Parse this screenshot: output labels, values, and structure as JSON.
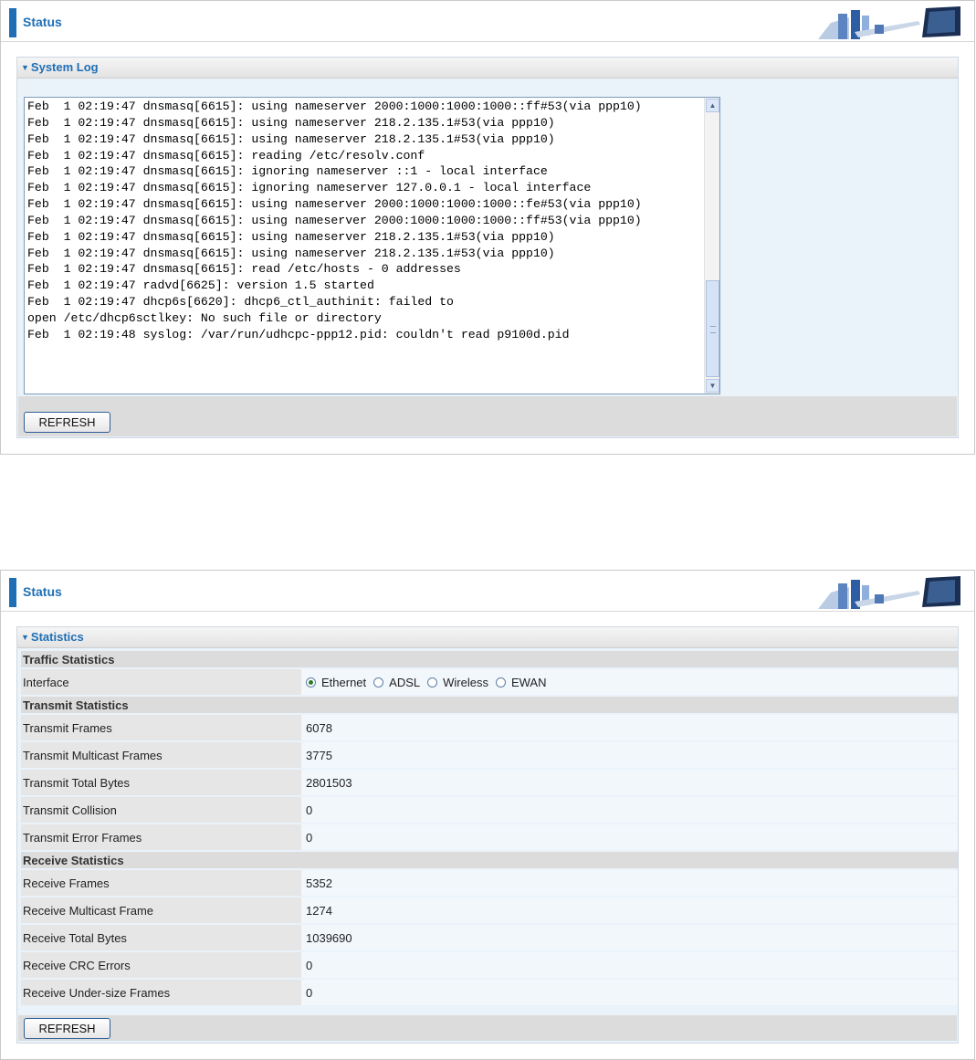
{
  "panel1": {
    "title": "Status",
    "section_title": "System Log",
    "log_text": "Feb  1 02:19:47 dnsmasq[6615]: using nameserver 2000:1000:1000:1000::ff#53(via ppp10)\nFeb  1 02:19:47 dnsmasq[6615]: using nameserver 218.2.135.1#53(via ppp10)\nFeb  1 02:19:47 dnsmasq[6615]: using nameserver 218.2.135.1#53(via ppp10)\nFeb  1 02:19:47 dnsmasq[6615]: reading /etc/resolv.conf\nFeb  1 02:19:47 dnsmasq[6615]: ignoring nameserver ::1 - local interface\nFeb  1 02:19:47 dnsmasq[6615]: ignoring nameserver 127.0.0.1 - local interface\nFeb  1 02:19:47 dnsmasq[6615]: using nameserver 2000:1000:1000:1000::fe#53(via ppp10)\nFeb  1 02:19:47 dnsmasq[6615]: using nameserver 2000:1000:1000:1000::ff#53(via ppp10)\nFeb  1 02:19:47 dnsmasq[6615]: using nameserver 218.2.135.1#53(via ppp10)\nFeb  1 02:19:47 dnsmasq[6615]: using nameserver 218.2.135.1#53(via ppp10)\nFeb  1 02:19:47 dnsmasq[6615]: read /etc/hosts - 0 addresses\nFeb  1 02:19:47 radvd[6625]: version 1.5 started\nFeb  1 02:19:47 dhcp6s[6620]: dhcp6_ctl_authinit: failed to\nopen /etc/dhcp6sctlkey: No such file or directory\nFeb  1 02:19:48 syslog: /var/run/udhcpc-ppp12.pid: couldn't read p9100d.pid",
    "refresh_label": "REFRESH"
  },
  "panel2": {
    "title": "Status",
    "section_title": "Statistics",
    "traffic_header": "Traffic Statistics",
    "interface_label": "Interface",
    "interface_options": [
      "Ethernet",
      "ADSL",
      "Wireless",
      "EWAN"
    ],
    "interface_selected": "Ethernet",
    "transmit_header": "Transmit Statistics",
    "transmit": [
      {
        "label": "Transmit Frames",
        "value": "6078"
      },
      {
        "label": "Transmit Multicast Frames",
        "value": "3775"
      },
      {
        "label": "Transmit Total Bytes",
        "value": "2801503"
      },
      {
        "label": "Transmit Collision",
        "value": "0"
      },
      {
        "label": "Transmit Error Frames",
        "value": "0"
      }
    ],
    "receive_header": "Receive Statistics",
    "receive": [
      {
        "label": "Receive Frames",
        "value": "5352"
      },
      {
        "label": "Receive Multicast Frame",
        "value": "1274"
      },
      {
        "label": "Receive Total Bytes",
        "value": "1039690"
      },
      {
        "label": "Receive CRC Errors",
        "value": "0"
      },
      {
        "label": "Receive Under-size Frames",
        "value": "0"
      }
    ],
    "refresh_label": "REFRESH"
  }
}
